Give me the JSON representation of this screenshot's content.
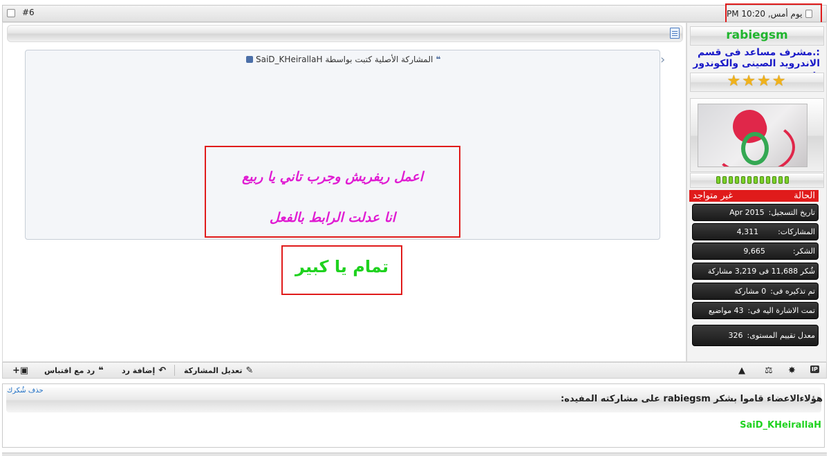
{
  "post": {
    "number": "#6",
    "date": "يوم أمس, 10:20 PM"
  },
  "quote": {
    "header": "المشاركة الأصلية كتبت بواسطة SaiD_KHeirallaH",
    "line1": "اعمل ريفريش وجرب تاني يا ربيع",
    "line2": "انا عدلت الرابط بالفعل"
  },
  "reply_text": "تمام يا كبير",
  "user": {
    "name": "rabiegsm",
    "title": ":.مشرف مساعد فى قسم الاندرويد الصينى والكوندور .:",
    "stars": "★★★★",
    "status_label": "الحالة",
    "status_value": "غير متواجد",
    "stats": [
      {
        "label": "تاريخ التسجيل:",
        "value": "Apr 2015"
      },
      {
        "label": "المشاركات:",
        "value": "4,311"
      },
      {
        "label": "الشكر:",
        "value": "9,665"
      },
      {
        "label": "شُكر 11,688 فى 3,219 مشاركة",
        "value": ""
      },
      {
        "label": "تم تذكيره فى:",
        "value": "0 مشاركة"
      },
      {
        "label": "تمت الاشارة اليه فى:",
        "value": "43 مواضيع"
      },
      {
        "label": "معدل تقييم المستوى:",
        "value": "326"
      }
    ]
  },
  "footer": {
    "edit_label": "تعديل المشاركة",
    "reply_label": "إضافة رد",
    "quote_reply_label": "رد مع اقتباس",
    "ip_label": "IP"
  },
  "thanks": {
    "remove_label": "حذف شُكرك",
    "text": "هؤلاءالاعضاء قاموا بشكر rabiegsm على مشاركته المفيده:",
    "users": [
      "SaiD_KHeirallaH"
    ]
  }
}
